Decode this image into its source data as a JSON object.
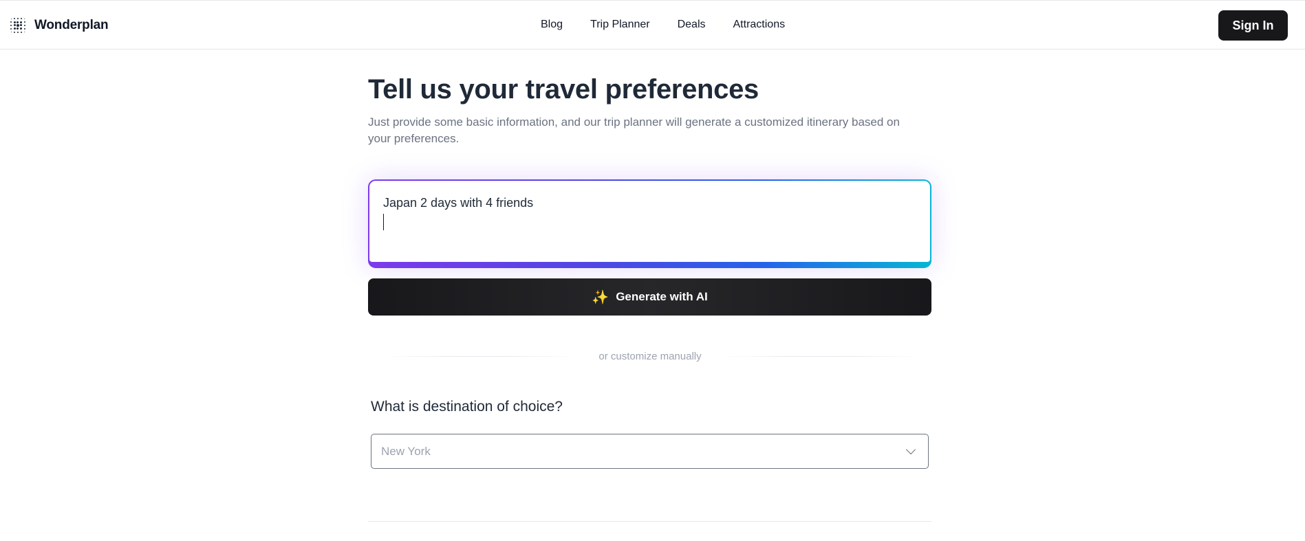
{
  "header": {
    "brand": "Wonderplan",
    "nav": [
      "Blog",
      "Trip Planner",
      "Deals",
      "Attractions"
    ],
    "sign_in": "Sign In"
  },
  "main": {
    "title": "Tell us your travel preferences",
    "subtitle": "Just provide some basic information, and our trip planner will generate a customized itinerary based on your preferences.",
    "prompt_value": "Japan 2 days with 4 friends",
    "generate_label": "Generate with AI",
    "generate_icon": "sparkles-icon",
    "divider_text": "or customize manually",
    "destination_question": "What is destination of choice?",
    "destination_placeholder": "New York"
  },
  "colors": {
    "primary_dark": "#18181b",
    "gradient_start": "#7c3aed",
    "gradient_end": "#06b6d4",
    "sparkle": "#fbbf24"
  }
}
